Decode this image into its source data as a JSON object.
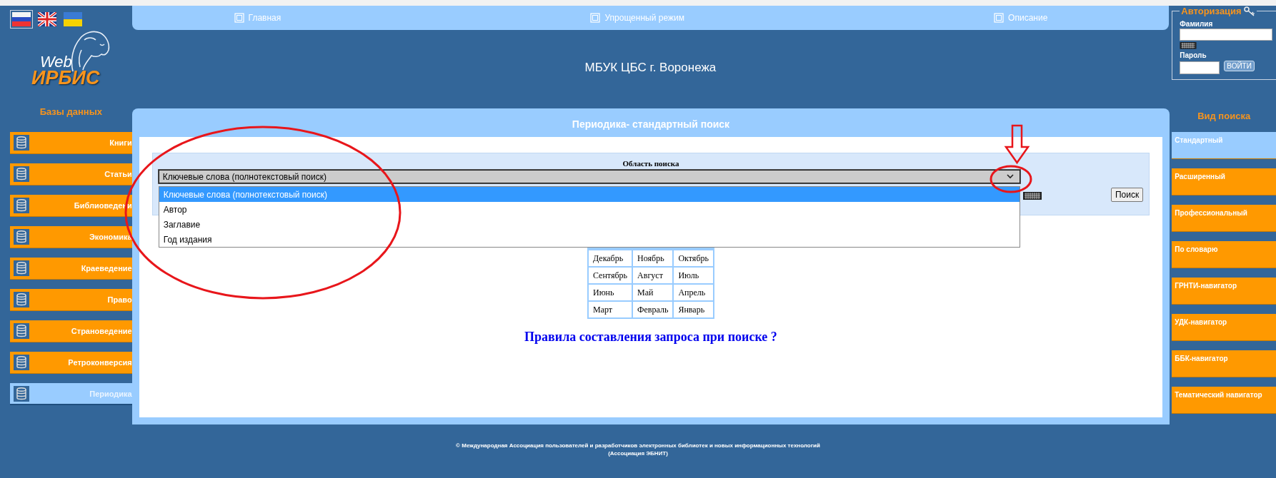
{
  "language_flags": [
    {
      "kind": "ru",
      "selected": true
    },
    {
      "kind": "en",
      "selected": false
    },
    {
      "kind": "ua",
      "selected": false
    }
  ],
  "logo": {
    "line1": "Web",
    "line2": "ИРБИС"
  },
  "nav": [
    {
      "label": "Главная"
    },
    {
      "label": "Упрощенный режим"
    },
    {
      "label": "Описание"
    }
  ],
  "site_title": "МБУК ЦБС г. Воронежа",
  "auth": {
    "legend": "Авторизация",
    "surname_label": "Фамилия",
    "password_label": "Пароль",
    "login_button": "ВОЙТИ"
  },
  "databases": {
    "heading": "Базы данных",
    "items": [
      {
        "label": "Книги",
        "selected": false
      },
      {
        "label": "Статьи",
        "selected": false
      },
      {
        "label": "Библиоведени",
        "selected": false
      },
      {
        "label": "Экономика",
        "selected": false
      },
      {
        "label": "Краеведение",
        "selected": false
      },
      {
        "label": "Право",
        "selected": false
      },
      {
        "label": "Страноведение",
        "selected": false
      },
      {
        "label": "Ретроконверсия",
        "selected": false
      },
      {
        "label": "Периодика",
        "selected": true
      }
    ]
  },
  "panel": {
    "title": "Периодика- стандартный поиск",
    "search_area": {
      "label": "Область поиска",
      "value": "Ключевые слова (полнотекстовый поиск)",
      "expanded": true,
      "options": [
        {
          "label": "Ключевые слова (полнотекстовый поиск)",
          "selected": true
        },
        {
          "label": "Автор",
          "selected": false
        },
        {
          "label": "Заглавие",
          "selected": false
        },
        {
          "label": "Год издания",
          "selected": false
        }
      ]
    },
    "search_button": "Поиск",
    "months": [
      [
        "Декабрь",
        "Ноябрь",
        "Октябрь"
      ],
      [
        "Сентябрь",
        "Август",
        "Июль"
      ],
      [
        "Июнь",
        "Май",
        "Апрель"
      ],
      [
        "Март",
        "Февраль",
        "Январь"
      ]
    ],
    "rules_link": "Правила составления запроса при поиске ?"
  },
  "search_types": {
    "heading": "Вид поиска",
    "items": [
      {
        "label": "Стандартный",
        "selected": true
      },
      {
        "label": "Расширенный",
        "selected": false
      },
      {
        "label": "Профессиональный",
        "selected": false
      },
      {
        "label": "По словарю",
        "selected": false
      },
      {
        "label": "ГРНТИ-навигатор",
        "selected": false
      },
      {
        "label": "УДК-навигатор",
        "selected": false
      },
      {
        "label": "ББК-навигатор",
        "selected": false
      },
      {
        "label": "Тематический навигатор",
        "selected": false
      }
    ]
  },
  "footer": [
    "© Международная Ассоциация пользователей и разработчиков электронных библиотек и новых информационных технологий",
    "(Ассоциация ЭБНИТ)"
  ]
}
